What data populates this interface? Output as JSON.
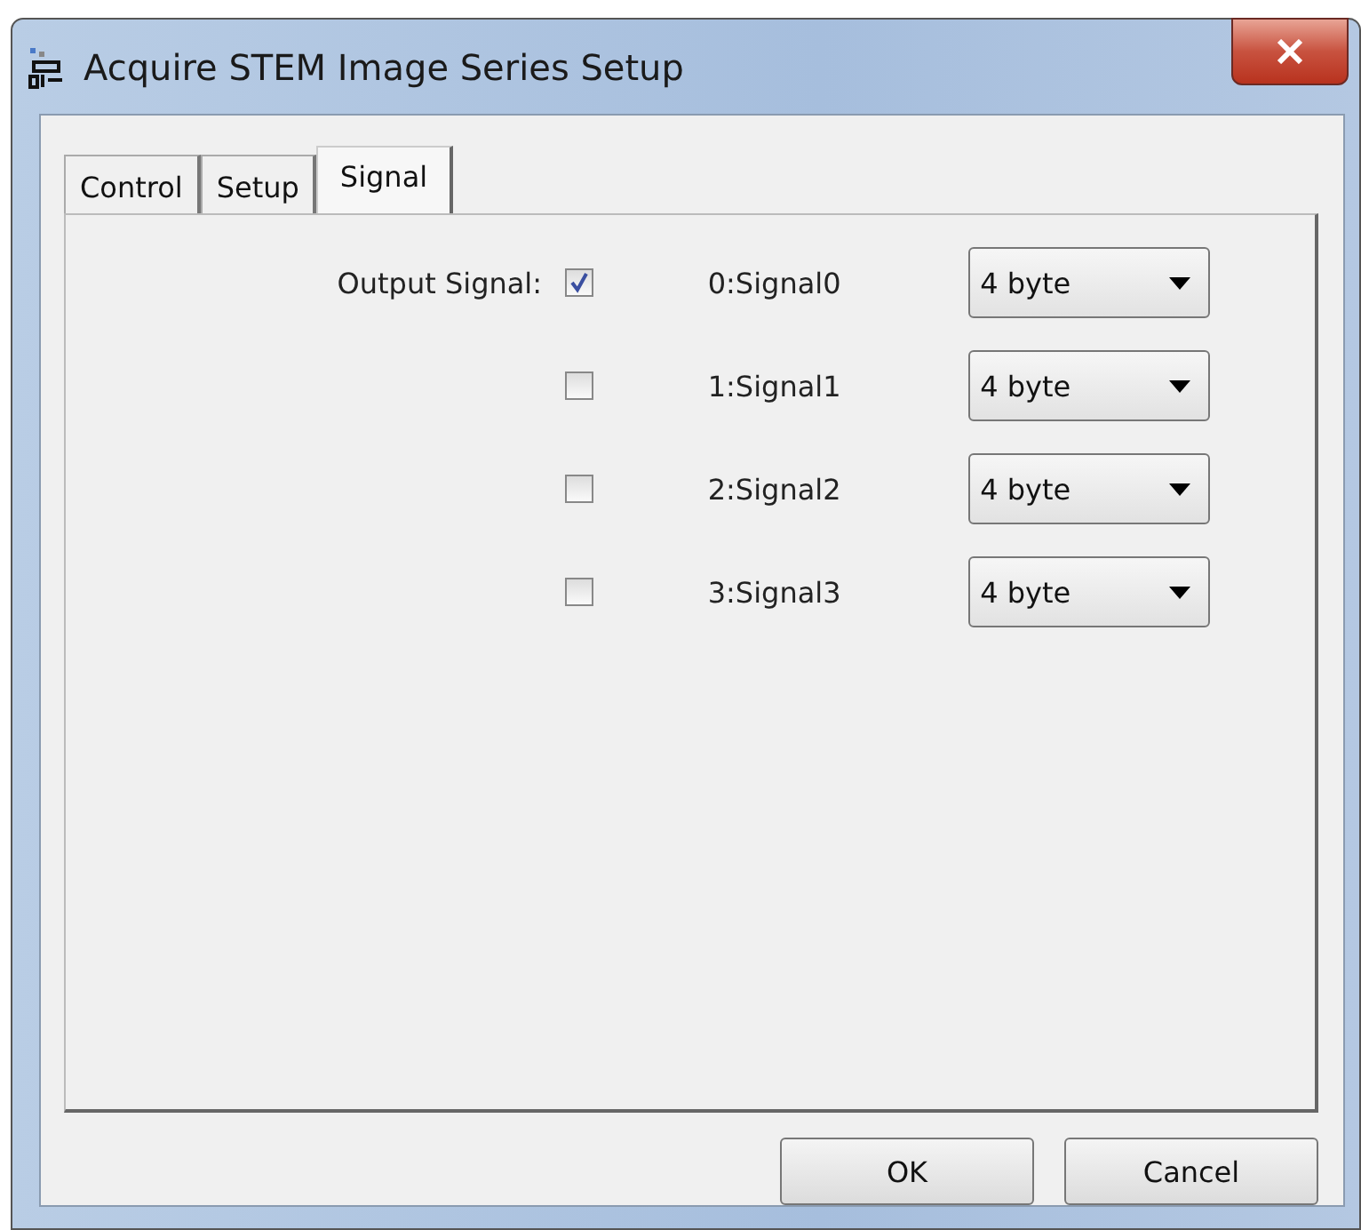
{
  "window": {
    "title": "Acquire STEM Image Series Setup"
  },
  "tabs": [
    {
      "label": "Control",
      "selected": false
    },
    {
      "label": "Setup",
      "selected": false
    },
    {
      "label": "Signal",
      "selected": true
    }
  ],
  "output_signal": {
    "label": "Output Signal:",
    "channels": [
      {
        "name": "0:Signal0",
        "checked": true,
        "format": "4 byte"
      },
      {
        "name": "1:Signal1",
        "checked": false,
        "format": "4 byte"
      },
      {
        "name": "2:Signal2",
        "checked": false,
        "format": "4 byte"
      },
      {
        "name": "3:Signal3",
        "checked": false,
        "format": "4 byte"
      }
    ]
  },
  "buttons": [
    "OK",
    "Cancel"
  ]
}
